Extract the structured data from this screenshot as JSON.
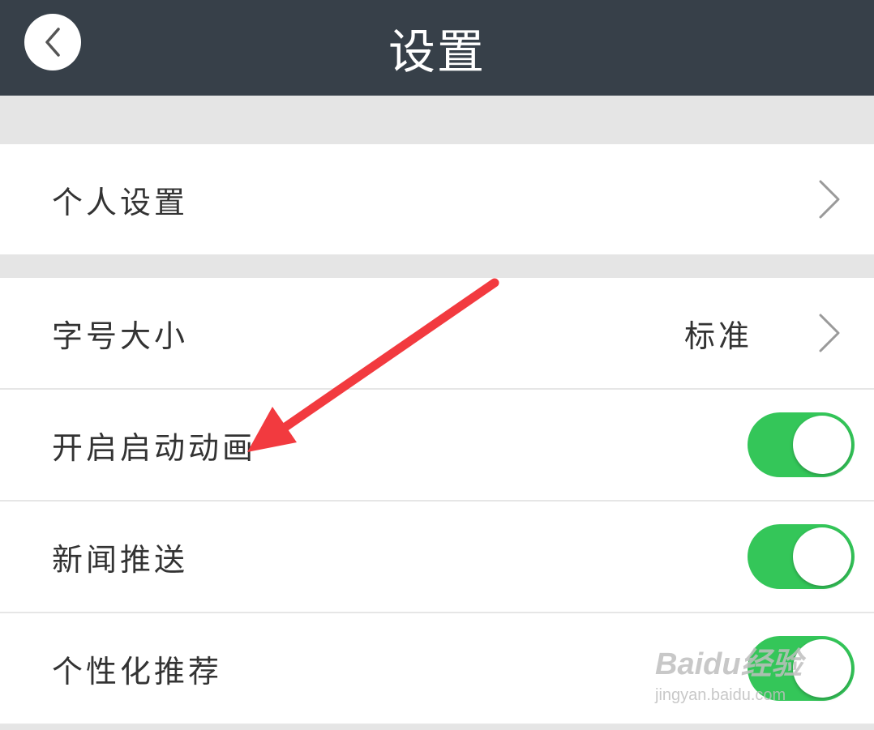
{
  "header": {
    "title": "设置",
    "back_icon": "chevron-left-icon"
  },
  "settings": {
    "personal": {
      "label": "个人设置",
      "icon": "chevron-right-icon"
    },
    "font_size": {
      "label": "字号大小",
      "value": "标准",
      "icon": "chevron-right-icon"
    },
    "startup_animation": {
      "label": "开启启动动画",
      "enabled": true
    },
    "news_push": {
      "label": "新闻推送",
      "enabled": true
    },
    "personalized": {
      "label": "个性化推荐",
      "enabled": true
    }
  },
  "colors": {
    "header_bg": "#374049",
    "toggle_on": "#34c659",
    "annotation_arrow": "#f23a3f",
    "separator": "#e5e5e5"
  },
  "watermark": {
    "brand": "Baidu经验",
    "url": "jingyan.baidu.com"
  }
}
